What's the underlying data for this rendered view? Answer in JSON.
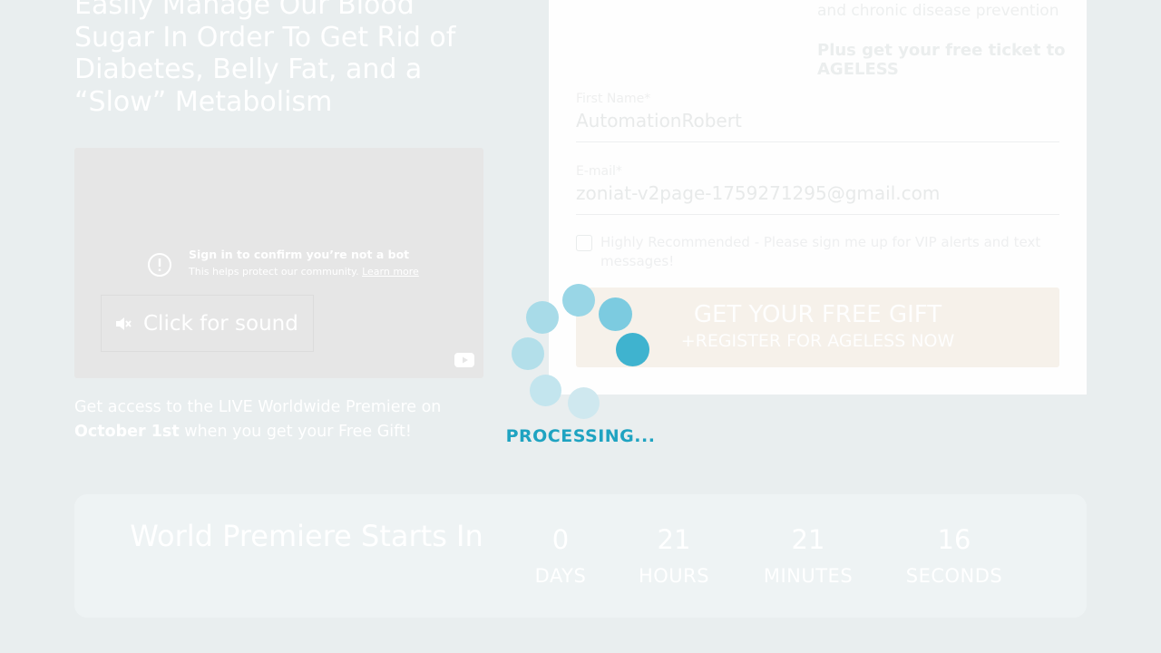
{
  "headline": {
    "lines": [
      "Easily Manage Our Blood",
      "Sugar In Order To Get Rid of",
      "Diabetes, Belly Fat, and a",
      "“Slow” Metabolism"
    ]
  },
  "video": {
    "bot_title": "Sign in to confirm you’re not a bot",
    "bot_sub": "This helps protect our community.",
    "learn_more": "Learn more",
    "sound_button": "Click for sound",
    "icons": [
      "alert-circle-icon",
      "mute-icon",
      "youtube-icon"
    ]
  },
  "access": {
    "prefix": "Get access to the LIVE Worldwide Premiere on",
    "date": "October 1st",
    "suffix": " when you get your Free Gift!"
  },
  "form": {
    "benefit_text": "and chronic disease prevention",
    "ticket_text": "Plus get your free ticket to AGELESS",
    "first_name": {
      "label": "First Name*",
      "value": "AutomationRobert"
    },
    "email": {
      "label": "E-mail*",
      "value": "zoniat-v2page-1759271295@gmail.com"
    },
    "sms_opt_in": {
      "label": "Highly Recommended - Please sign me up for VIP alerts and text messages!",
      "checked": false
    },
    "submit": {
      "main": "GET YOUR FREE GIFT",
      "sub": "+REGISTER FOR AGELESS NOW"
    }
  },
  "countdown": {
    "title": "World Premiere Starts In",
    "days": {
      "value": "0",
      "label": "DAYS"
    },
    "hours": {
      "value": "21",
      "label": "HOURS"
    },
    "minutes": {
      "value": "21",
      "label": "MINUTES"
    },
    "seconds": {
      "value": "16",
      "label": "SECONDS"
    }
  },
  "overlay": {
    "status": "PROCESSING...",
    "accent_color": "#1fa3c1"
  }
}
